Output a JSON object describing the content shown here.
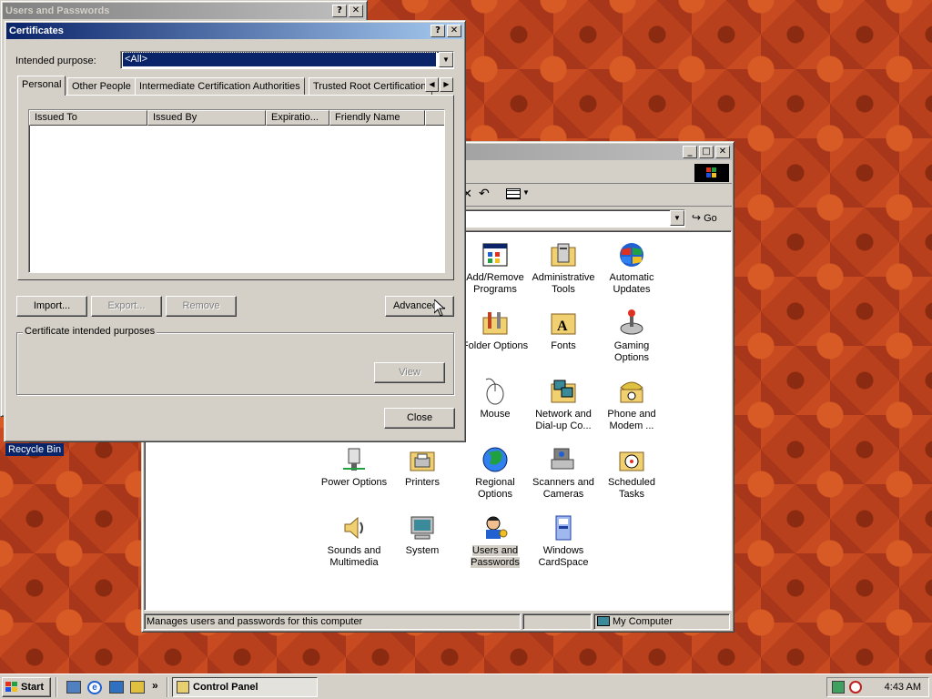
{
  "desktop": {
    "recycle_bin_label": "Recycle Bin"
  },
  "users_window": {
    "title": "Users and Passwords",
    "help": "?",
    "close": "✕"
  },
  "certs": {
    "title": "Certificates",
    "help": "?",
    "close": "✕",
    "purpose_label": "Intended purpose:",
    "purpose_value": "<All>",
    "tabs": [
      "Personal",
      "Other People",
      "Intermediate Certification Authorities",
      "Trusted Root Certification"
    ],
    "columns": [
      "Issued To",
      "Issued By",
      "Expiratio...",
      "Friendly Name"
    ],
    "buttons": {
      "import": "Import...",
      "export": "Export...",
      "remove": "Remove",
      "advanced": "Advanced...",
      "view": "View",
      "close": "Close"
    },
    "group_label": "Certificate intended purposes"
  },
  "control_panel": {
    "title_controls": {
      "minimize": "_",
      "maximize": "□",
      "close": "✕"
    },
    "go_label": "Go",
    "status_text": "Manages users and passwords for this computer",
    "status_zone": "My Computer",
    "icons": [
      {
        "label": "Add/Remove Programs",
        "icon": "add-remove-programs-icon"
      },
      {
        "label": "Administrative Tools",
        "icon": "administrative-tools-icon"
      },
      {
        "label": "Automatic Updates",
        "icon": "automatic-updates-icon"
      },
      {
        "label": "Folder Options",
        "icon": "folder-options-icon"
      },
      {
        "label": "Fonts",
        "icon": "fonts-icon"
      },
      {
        "label": "Gaming Options",
        "icon": "gaming-options-icon"
      },
      {
        "label": "Mouse",
        "icon": "mouse-icon"
      },
      {
        "label": "Network and Dial-up Co...",
        "icon": "network-icon"
      },
      {
        "label": "Phone and Modem ...",
        "icon": "phone-modem-icon"
      },
      {
        "label": "Power Options",
        "icon": "power-options-icon"
      },
      {
        "label": "Printers",
        "icon": "printers-icon"
      },
      {
        "label": "Regional Options",
        "icon": "regional-options-icon"
      },
      {
        "label": "Scanners and Cameras",
        "icon": "scanners-cameras-icon"
      },
      {
        "label": "Scheduled Tasks",
        "icon": "scheduled-tasks-icon"
      },
      {
        "label": "Sounds and Multimedia",
        "icon": "sounds-icon"
      },
      {
        "label": "System",
        "icon": "system-icon"
      },
      {
        "label": "Users and Passwords",
        "icon": "users-passwords-icon"
      },
      {
        "label": "Windows CardSpace",
        "icon": "cardspace-icon"
      }
    ]
  },
  "taskbar": {
    "start_label": "Start",
    "quicklaunch_more": "»",
    "task_label": "Control Panel",
    "clock": "4:43 AM"
  }
}
